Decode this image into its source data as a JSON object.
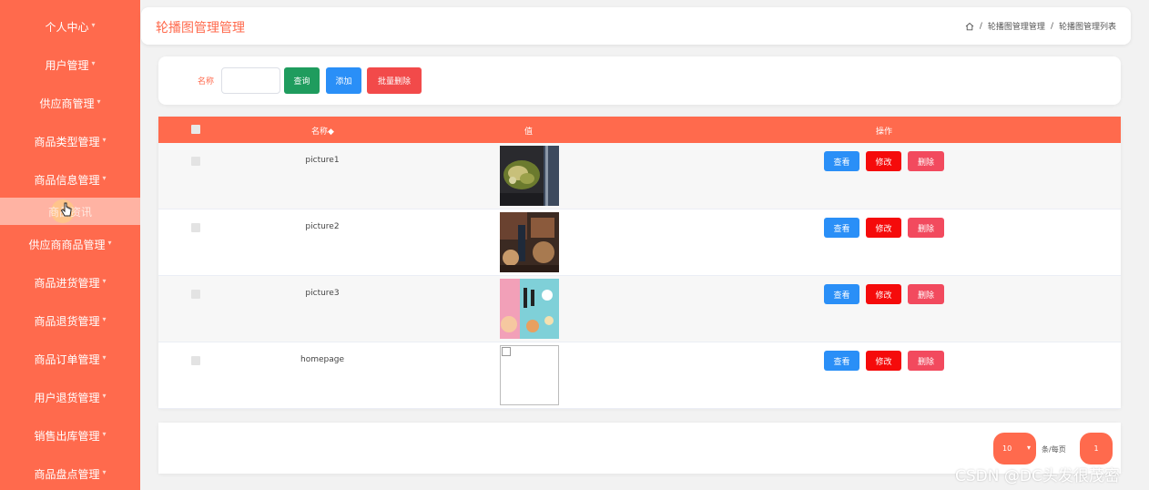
{
  "sidebar": {
    "items": [
      {
        "label": "个人中心"
      },
      {
        "label": "用户管理"
      },
      {
        "label": "供应商管理"
      },
      {
        "label": "商品类型管理"
      },
      {
        "label": "商品信息管理"
      },
      {
        "label": "商品资讯"
      },
      {
        "label": "供应商商品管理"
      },
      {
        "label": "商品进货管理"
      },
      {
        "label": "商品退货管理"
      },
      {
        "label": "商品订单管理"
      },
      {
        "label": "用户退货管理"
      },
      {
        "label": "销售出库管理"
      },
      {
        "label": "商品盘点管理"
      }
    ],
    "caret": "▾"
  },
  "header": {
    "title": "轮播图管理管理",
    "breadcrumb": {
      "sep": "/",
      "item1": "轮播图管理管理",
      "item2": "轮播图管理列表"
    }
  },
  "search": {
    "label": "名称",
    "value": "",
    "query_button": "查询",
    "add_button": "添加",
    "batch_delete_button": "批量删除"
  },
  "table": {
    "columns": {
      "name": "名称◆",
      "value": "值",
      "actions": "操作"
    },
    "rows": [
      {
        "name": "picture1"
      },
      {
        "name": "picture2"
      },
      {
        "name": "picture3"
      },
      {
        "name": "homepage"
      }
    ],
    "actions": {
      "view": "查看",
      "edit": "修改",
      "delete": "删除"
    }
  },
  "pagination": {
    "page_size": "10",
    "per_page_label": "条/每页",
    "current_page": "1"
  },
  "watermark": "CSDN @DC头发很茂密",
  "colors": {
    "accent": "#ff6a4d",
    "primary": "#2a8ff7",
    "success": "#1f9c5e",
    "danger": "#f50b0b"
  }
}
